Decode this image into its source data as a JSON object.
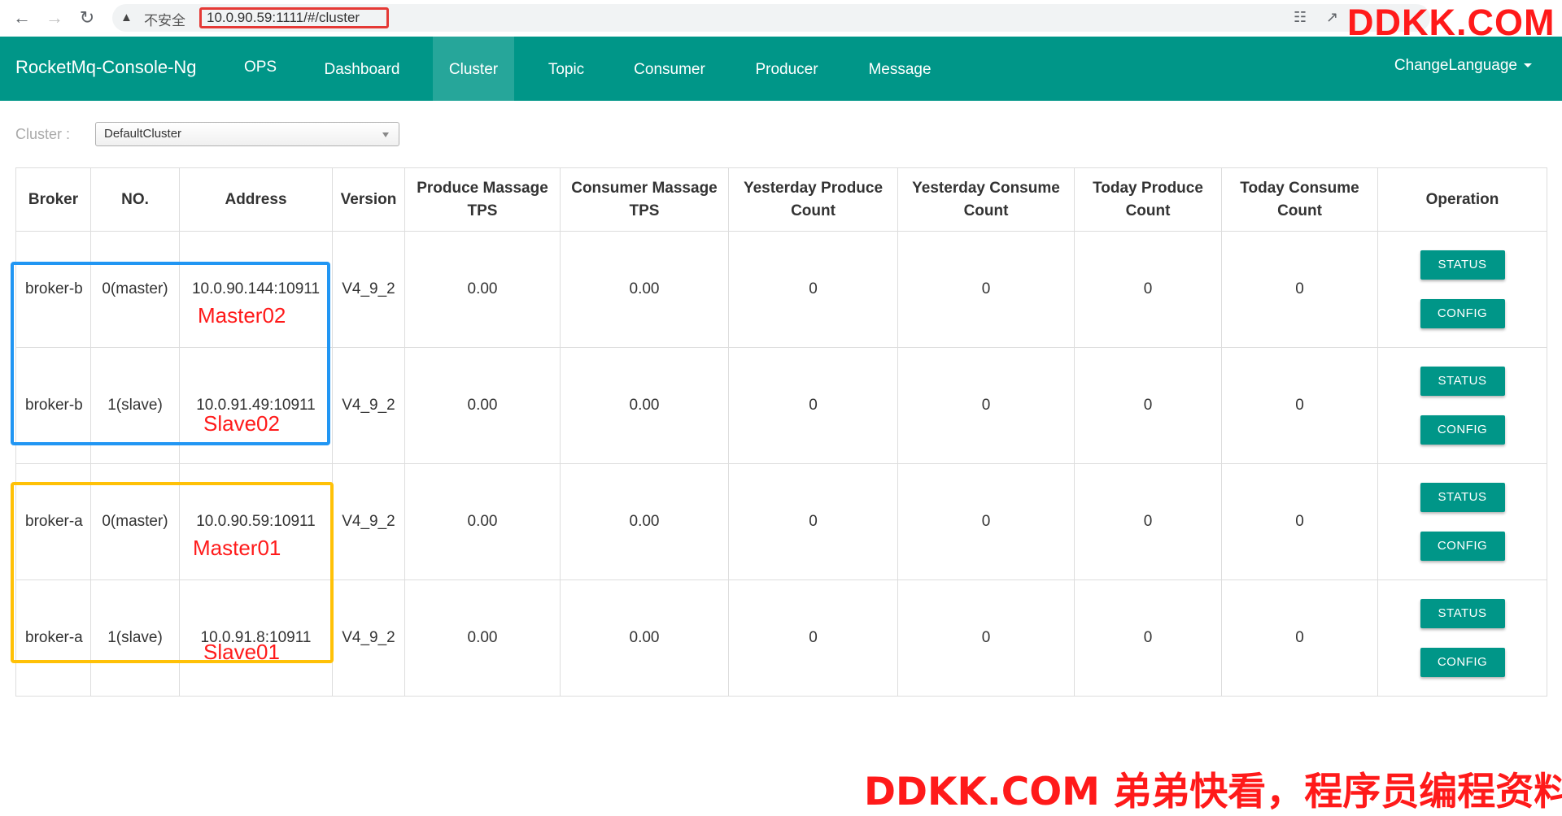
{
  "browser": {
    "insecure_label": "不安全",
    "url": "10.0.90.59:1111/#/cluster",
    "watermark_top": "DDKK.COM"
  },
  "nav": {
    "brand": "RocketMq-Console-Ng",
    "items": [
      "OPS",
      "Dashboard",
      "Cluster",
      "Topic",
      "Consumer",
      "Producer",
      "Message"
    ],
    "active": "Cluster",
    "language": "ChangeLanguage"
  },
  "filter": {
    "label": "Cluster :",
    "selected": "DefaultCluster"
  },
  "table": {
    "headers": [
      "Broker",
      "NO.",
      "Address",
      "Version",
      "Produce Massage TPS",
      "Consumer Massage TPS",
      "Yesterday Produce Count",
      "Yesterday Consume Count",
      "Today Produce Count",
      "Today Consume Count",
      "Operation"
    ],
    "rows": [
      {
        "broker": "broker-b",
        "no": "0(master)",
        "address": "10.0.90.144:10911",
        "version": "V4_9_2",
        "produce_tps": "0.00",
        "consumer_tps": "0.00",
        "y_produce": "0",
        "y_consume": "0",
        "t_produce": "0",
        "t_consume": "0"
      },
      {
        "broker": "broker-b",
        "no": "1(slave)",
        "address": "10.0.91.49:10911",
        "version": "V4_9_2",
        "produce_tps": "0.00",
        "consumer_tps": "0.00",
        "y_produce": "0",
        "y_consume": "0",
        "t_produce": "0",
        "t_consume": "0"
      },
      {
        "broker": "broker-a",
        "no": "0(master)",
        "address": "10.0.90.59:10911",
        "version": "V4_9_2",
        "produce_tps": "0.00",
        "consumer_tps": "0.00",
        "y_produce": "0",
        "y_consume": "0",
        "t_produce": "0",
        "t_consume": "0"
      },
      {
        "broker": "broker-a",
        "no": "1(slave)",
        "address": "10.0.91.8:10911",
        "version": "V4_9_2",
        "produce_tps": "0.00",
        "consumer_tps": "0.00",
        "y_produce": "0",
        "y_consume": "0",
        "t_produce": "0",
        "t_consume": "0"
      }
    ],
    "status_label": "STATUS",
    "config_label": "CONFIG"
  },
  "annotations": {
    "master02": "Master02",
    "slave02": "Slave02",
    "master01": "Master01",
    "slave01": "Slave01"
  },
  "watermark_bottom": "DDKK.COM 弟弟快看，程序员编程资料站",
  "colors": {
    "navbar": "#009688",
    "active_tab": "#26a69a",
    "button": "#009688",
    "annotation_red": "#ff1a1a",
    "box_blue": "#2196f3",
    "box_yellow": "#ffc107"
  }
}
